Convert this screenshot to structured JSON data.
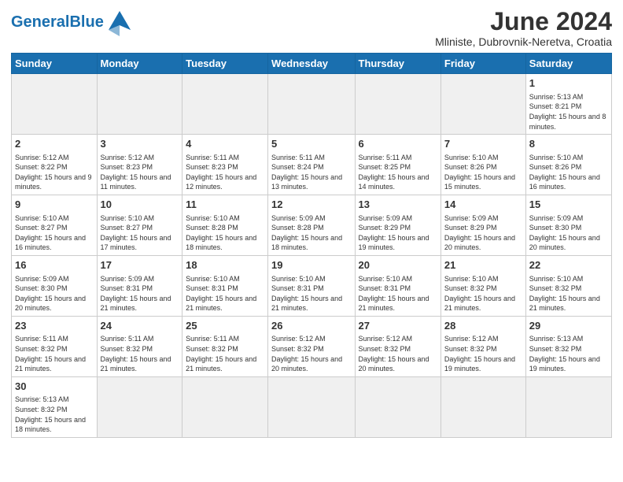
{
  "header": {
    "logo_general": "General",
    "logo_blue": "Blue",
    "month_title": "June 2024",
    "location": "Mliniste, Dubrovnik-Neretva, Croatia"
  },
  "weekdays": [
    "Sunday",
    "Monday",
    "Tuesday",
    "Wednesday",
    "Thursday",
    "Friday",
    "Saturday"
  ],
  "days": {
    "1": {
      "sunrise": "5:13 AM",
      "sunset": "8:21 PM",
      "daylight": "15 hours and 8 minutes."
    },
    "2": {
      "sunrise": "5:12 AM",
      "sunset": "8:22 PM",
      "daylight": "15 hours and 9 minutes."
    },
    "3": {
      "sunrise": "5:12 AM",
      "sunset": "8:23 PM",
      "daylight": "15 hours and 11 minutes."
    },
    "4": {
      "sunrise": "5:11 AM",
      "sunset": "8:23 PM",
      "daylight": "15 hours and 12 minutes."
    },
    "5": {
      "sunrise": "5:11 AM",
      "sunset": "8:24 PM",
      "daylight": "15 hours and 13 minutes."
    },
    "6": {
      "sunrise": "5:11 AM",
      "sunset": "8:25 PM",
      "daylight": "15 hours and 14 minutes."
    },
    "7": {
      "sunrise": "5:10 AM",
      "sunset": "8:26 PM",
      "daylight": "15 hours and 15 minutes."
    },
    "8": {
      "sunrise": "5:10 AM",
      "sunset": "8:26 PM",
      "daylight": "15 hours and 16 minutes."
    },
    "9": {
      "sunrise": "5:10 AM",
      "sunset": "8:27 PM",
      "daylight": "15 hours and 16 minutes."
    },
    "10": {
      "sunrise": "5:10 AM",
      "sunset": "8:27 PM",
      "daylight": "15 hours and 17 minutes."
    },
    "11": {
      "sunrise": "5:10 AM",
      "sunset": "8:28 PM",
      "daylight": "15 hours and 18 minutes."
    },
    "12": {
      "sunrise": "5:09 AM",
      "sunset": "8:28 PM",
      "daylight": "15 hours and 18 minutes."
    },
    "13": {
      "sunrise": "5:09 AM",
      "sunset": "8:29 PM",
      "daylight": "15 hours and 19 minutes."
    },
    "14": {
      "sunrise": "5:09 AM",
      "sunset": "8:29 PM",
      "daylight": "15 hours and 20 minutes."
    },
    "15": {
      "sunrise": "5:09 AM",
      "sunset": "8:30 PM",
      "daylight": "15 hours and 20 minutes."
    },
    "16": {
      "sunrise": "5:09 AM",
      "sunset": "8:30 PM",
      "daylight": "15 hours and 20 minutes."
    },
    "17": {
      "sunrise": "5:09 AM",
      "sunset": "8:31 PM",
      "daylight": "15 hours and 21 minutes."
    },
    "18": {
      "sunrise": "5:10 AM",
      "sunset": "8:31 PM",
      "daylight": "15 hours and 21 minutes."
    },
    "19": {
      "sunrise": "5:10 AM",
      "sunset": "8:31 PM",
      "daylight": "15 hours and 21 minutes."
    },
    "20": {
      "sunrise": "5:10 AM",
      "sunset": "8:31 PM",
      "daylight": "15 hours and 21 minutes."
    },
    "21": {
      "sunrise": "5:10 AM",
      "sunset": "8:32 PM",
      "daylight": "15 hours and 21 minutes."
    },
    "22": {
      "sunrise": "5:10 AM",
      "sunset": "8:32 PM",
      "daylight": "15 hours and 21 minutes."
    },
    "23": {
      "sunrise": "5:11 AM",
      "sunset": "8:32 PM",
      "daylight": "15 hours and 21 minutes."
    },
    "24": {
      "sunrise": "5:11 AM",
      "sunset": "8:32 PM",
      "daylight": "15 hours and 21 minutes."
    },
    "25": {
      "sunrise": "5:11 AM",
      "sunset": "8:32 PM",
      "daylight": "15 hours and 21 minutes."
    },
    "26": {
      "sunrise": "5:12 AM",
      "sunset": "8:32 PM",
      "daylight": "15 hours and 20 minutes."
    },
    "27": {
      "sunrise": "5:12 AM",
      "sunset": "8:32 PM",
      "daylight": "15 hours and 20 minutes."
    },
    "28": {
      "sunrise": "5:12 AM",
      "sunset": "8:32 PM",
      "daylight": "15 hours and 19 minutes."
    },
    "29": {
      "sunrise": "5:13 AM",
      "sunset": "8:32 PM",
      "daylight": "15 hours and 19 minutes."
    },
    "30": {
      "sunrise": "5:13 AM",
      "sunset": "8:32 PM",
      "daylight": "15 hours and 18 minutes."
    }
  }
}
